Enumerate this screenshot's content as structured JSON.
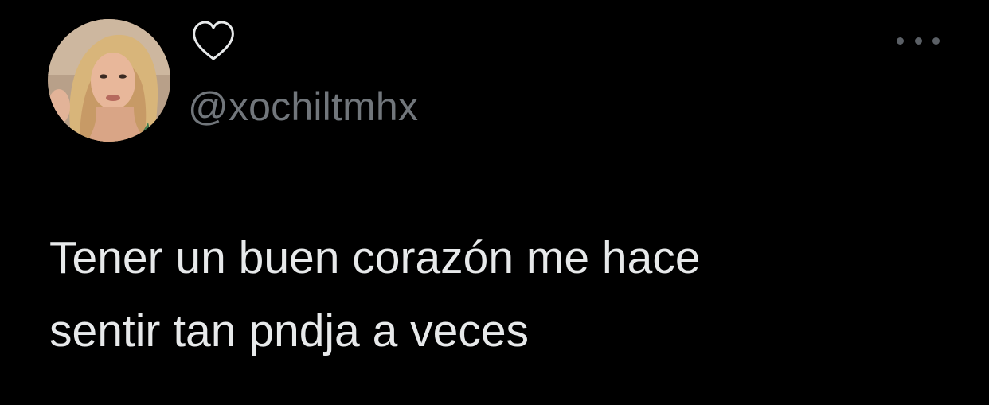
{
  "tweet": {
    "display_name_icon": "heart-outline-icon",
    "handle": "@xochiltmhx",
    "more_icon": "more-horizontal-icon",
    "text_lines": [
      "Tener un buen corazón me hace",
      "sentir tan pndja a veces"
    ],
    "colors": {
      "background": "#000000",
      "text": "#e7e9ea",
      "secondary_text": "#71767b"
    }
  }
}
